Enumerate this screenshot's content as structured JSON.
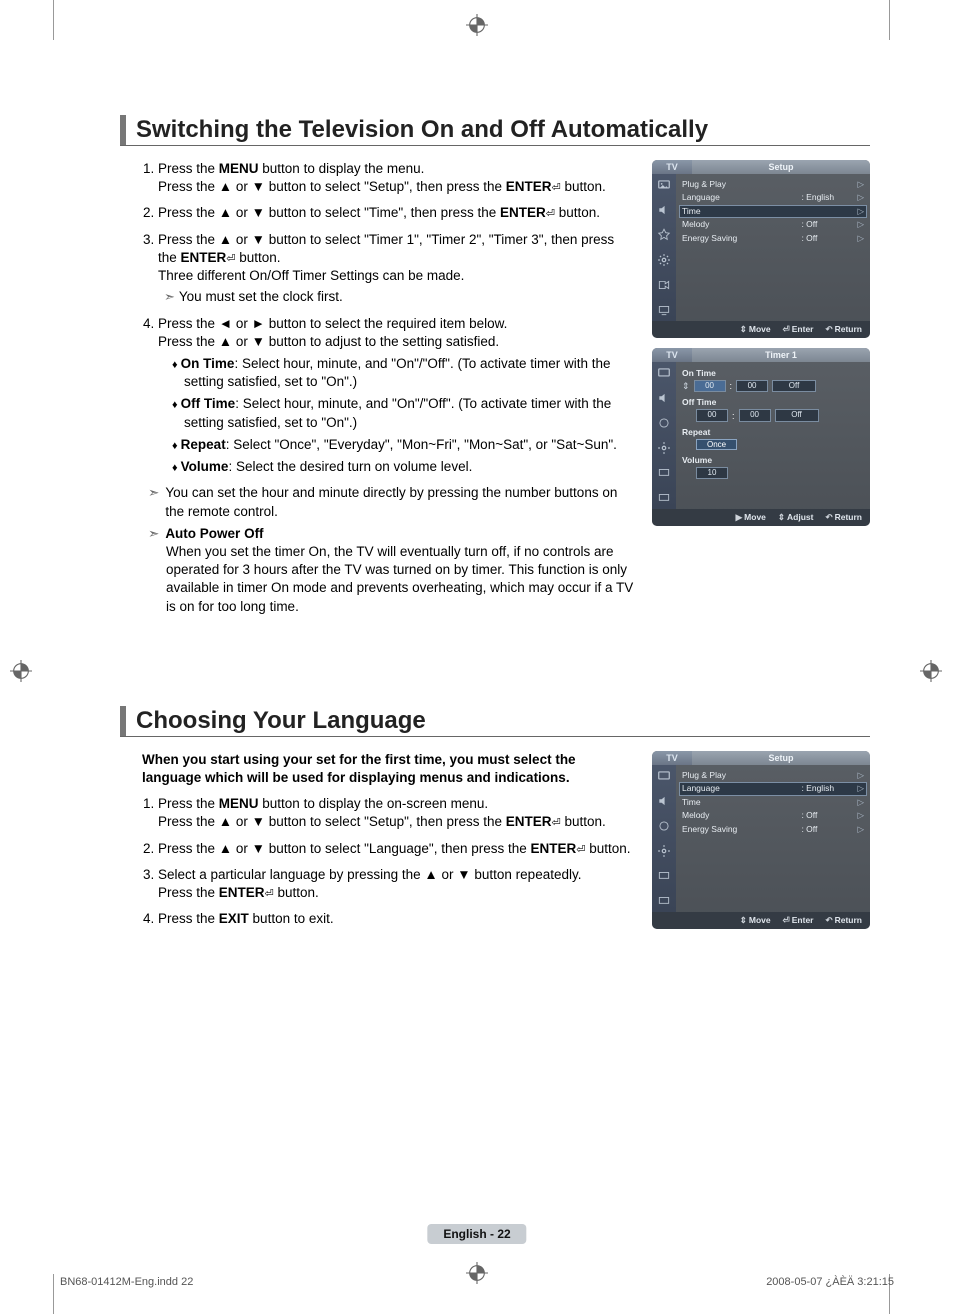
{
  "section1": {
    "title": "Switching the Television On and Off Automatically",
    "step1a": "Press the ",
    "menu_word": "MENU",
    "step1b": " button to display the menu.",
    "step1c": "Press the ▲ or ▼ button to select \"Setup\", then press the ",
    "enter_word": "ENTER",
    "button_suffix": " button.",
    "step2": "Press the ▲ or ▼ button to select \"Time\", then press the ",
    "step3a": "Press the ▲ or ▼ button to select \"Timer 1\", \"Timer 2\", \"Timer 3\", then press the ",
    "step3b": "Three different On/Off Timer Settings can be made.",
    "step3_note": "You must set the clock first.",
    "step4a": "Press the ◄ or ► button to select the required item below.",
    "step4b": "Press the ▲ or ▼ button to adjust to the setting satisfied.",
    "bullet_on_label": "On  Time",
    "bullet_on_text": ": Select hour, minute, and \"On\"/\"Off\". (To activate timer with the setting satisfied, set to \"On\".)",
    "bullet_off_label": "Off  Time",
    "bullet_off_text": ": Select hour, minute, and \"On\"/\"Off\". (To activate timer with the setting satisfied, set to \"On\".)",
    "bullet_repeat_label": "Repeat",
    "bullet_repeat_text": ": Select \"Once\", \"Everyday\", \"Mon~Fri\", \"Mon~Sat\", or \"Sat~Sun\".",
    "bullet_volume_label": "Volume",
    "bullet_volume_text": ": Select the desired turn on volume level.",
    "note_direct": "You can set the hour and minute directly by pressing the number buttons on the remote control.",
    "note_auto_label": "Auto Power Off",
    "note_auto_text": "When you set the timer On, the TV will eventually turn off, if no controls are operated for 3 hours after the TV was turned on by timer. This function is only available in timer On mode and prevents overheating, which may occur if a TV is on for too long time."
  },
  "section2": {
    "title": "Choosing Your Language",
    "lead": "When you start using your set for the first time, you must select the language which will be used for displaying menus and indications.",
    "step1a": "Press the ",
    "step1b": " button to display the on-screen menu.",
    "step1c": "Press the ▲ or ▼ button to select \"Setup\", then press the ",
    "step2": "Press the ▲ or ▼ button to select \"Language\", then press the ",
    "step3a": "Select a particular language by pressing the ▲ or ▼ button repeatedly.",
    "step3b": "Press the ",
    "step4a": "Press the ",
    "exit_word": "EXIT",
    "step4b": " button to exit."
  },
  "osd": {
    "tv": "TV",
    "setup": "Setup",
    "timer1": "Timer 1",
    "plug": "Plug & Play",
    "language": "Language",
    "lang_val": ": English",
    "time": "Time",
    "melody": "Melody",
    "melody_val": ": Off",
    "energy": "Energy Saving",
    "energy_val": ": Off",
    "ontime": "On Time",
    "offtime": "Off Time",
    "repeat": "Repeat",
    "once": "Once",
    "volume": "Volume",
    "v10": "10",
    "h00": "00",
    "off": "Off",
    "colon": ":",
    "move": "Move",
    "enter": "Enter",
    "return": "Return",
    "adjust": "Adjust"
  },
  "footer": {
    "page_label": "English - 22",
    "imprint_left": "BN68-01412M-Eng.indd   22",
    "imprint_right": "2008-05-07   ¿ÀÈÄ 3:21:15"
  }
}
